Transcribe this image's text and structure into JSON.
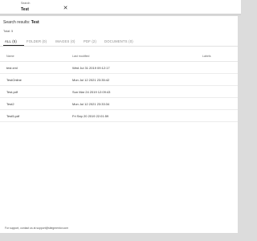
{
  "search": {
    "label": "Search",
    "value": "Test"
  },
  "results": {
    "prefix": "Search results: ",
    "query": "Test",
    "total": "Total: 5"
  },
  "tabs": [
    {
      "label": "ALL (5)",
      "active": true
    },
    {
      "label": "FOLDER (0)",
      "active": false
    },
    {
      "label": "IMAGES (0)",
      "active": false
    },
    {
      "label": "PDF (2)",
      "active": false
    },
    {
      "label": "DOCUMENTS (0)",
      "active": false
    }
  ],
  "table": {
    "headers": [
      "Name",
      "Last modified",
      "Labels"
    ],
    "rows": [
      {
        "name": "test.xml",
        "modified": "Wed Jul 31 2019 09:12:17",
        "labels": ""
      },
      {
        "name": "TestOnline",
        "modified": "Mon Jul 12 2021 23:35:42",
        "labels": ""
      },
      {
        "name": "Test.pdf",
        "modified": "Sun Mar 24 2019 12:09:43",
        "labels": ""
      },
      {
        "name": "Test2",
        "modified": "Mon Jul 12 2021 23:33:34",
        "labels": ""
      },
      {
        "name": "Test5.pdf",
        "modified": "Fri Sep 20 2019 22:01:59",
        "labels": ""
      }
    ]
  },
  "footer": {
    "text": "For support, contact us at support@sitegmentor.com"
  },
  "colors": {
    "background": "#dcdcdc",
    "panel": "#ffffff",
    "active_tab": "#222222"
  }
}
